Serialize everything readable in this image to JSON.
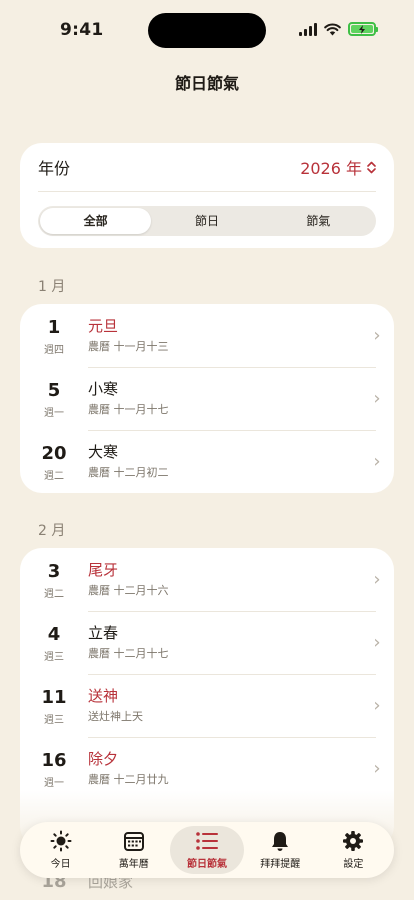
{
  "status": {
    "time": "9:41"
  },
  "page": {
    "title": "節日節氣"
  },
  "filter": {
    "year_label": "年份",
    "year_value": "2026 年",
    "segments": [
      "全部",
      "節日",
      "節氣"
    ],
    "active_segment": "全部"
  },
  "months": [
    {
      "label": "1 月",
      "items": [
        {
          "day": "1",
          "weekday": "週四",
          "name": "元旦",
          "sub": "農曆 十一月十三",
          "highlight": true
        },
        {
          "day": "5",
          "weekday": "週一",
          "name": "小寒",
          "sub": "農曆 十一月十七",
          "highlight": false
        },
        {
          "day": "20",
          "weekday": "週二",
          "name": "大寒",
          "sub": "農曆 十二月初二",
          "highlight": false
        }
      ]
    },
    {
      "label": "2 月",
      "items": [
        {
          "day": "3",
          "weekday": "週二",
          "name": "尾牙",
          "sub": "農曆 十二月十六",
          "highlight": true
        },
        {
          "day": "4",
          "weekday": "週三",
          "name": "立春",
          "sub": "農曆 十二月十七",
          "highlight": false
        },
        {
          "day": "11",
          "weekday": "週三",
          "name": "送神",
          "sub": "送灶神上天",
          "highlight": true
        },
        {
          "day": "16",
          "weekday": "週一",
          "name": "除夕",
          "sub": "農曆 十二月廿九",
          "highlight": true
        }
      ]
    }
  ],
  "peek": {
    "day": "18",
    "name": "回娘家"
  },
  "tabs": [
    {
      "label": "今日",
      "icon": "sun-icon"
    },
    {
      "label": "萬年曆",
      "icon": "calendar-icon"
    },
    {
      "label": "節日節氣",
      "icon": "list-icon"
    },
    {
      "label": "拜拜提醒",
      "icon": "bell-icon"
    },
    {
      "label": "設定",
      "icon": "gear-icon"
    }
  ],
  "active_tab": "節日節氣",
  "colors": {
    "accent": "#b8323a",
    "background": "#f5efe3",
    "card": "#ffffff"
  }
}
